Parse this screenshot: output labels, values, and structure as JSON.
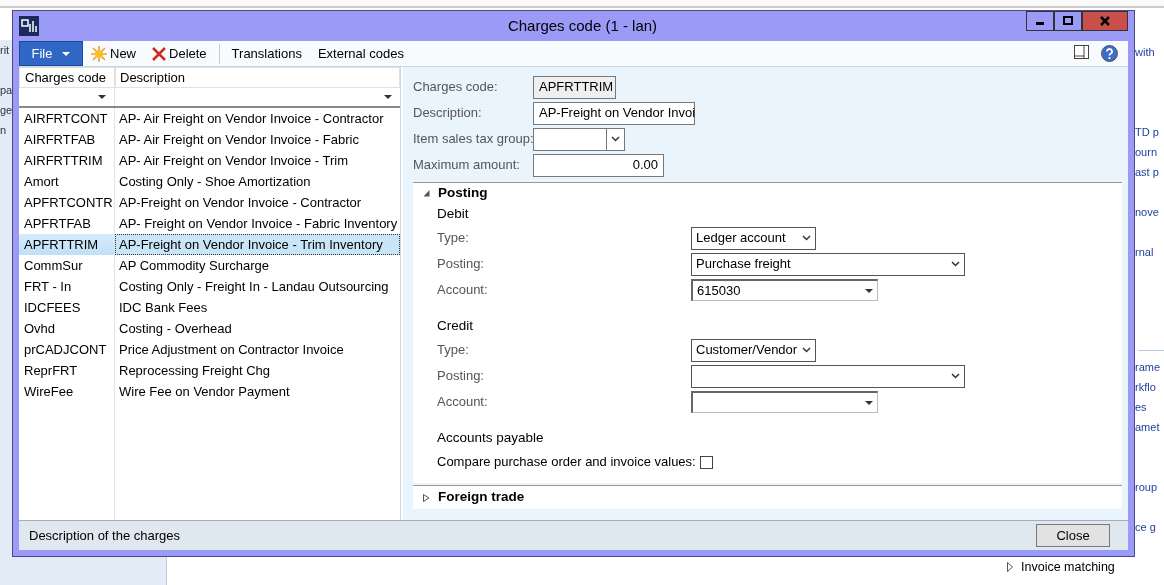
{
  "window": {
    "title": "Charges code (1 - lan)"
  },
  "toolbar": {
    "file_button": "File",
    "buttons": [
      {
        "label": "New",
        "kind": "new"
      },
      {
        "label": "Delete",
        "kind": "delete"
      },
      {
        "label": "Translations",
        "kind": "plain"
      },
      {
        "label": "External codes",
        "kind": "plain"
      }
    ]
  },
  "grid": {
    "columns": [
      "Charges code",
      "Description"
    ],
    "rows": [
      {
        "code": "AIRFRTCONT",
        "description": "AP- Air Freight on Vendor Invoice - Contractor",
        "selected": false
      },
      {
        "code": "AIRFRTFAB",
        "description": "AP- Air Freight on Vendor Invoice - Fabric",
        "selected": false
      },
      {
        "code": "AIRFRTTRIM",
        "description": "AP- Air Freight on Vendor Invoice - Trim",
        "selected": false
      },
      {
        "code": "Amort",
        "description": "Costing Only - Shoe Amortization",
        "selected": false
      },
      {
        "code": "APFRTCONTR",
        "description": "AP-Freight on Vendor Invoice - Contractor",
        "selected": false
      },
      {
        "code": "APFRTFAB",
        "description": "AP- Freight on Vendor Invoice - Fabric Inventory",
        "selected": false
      },
      {
        "code": "APFRTTRIM",
        "description": "AP-Freight on Vendor Invoice - Trim Inventory",
        "selected": true
      },
      {
        "code": "CommSur",
        "description": "AP Commodity Surcharge",
        "selected": false
      },
      {
        "code": "FRT - In",
        "description": "Costing Only - Freight In - Landau Outsourcing",
        "selected": false
      },
      {
        "code": "IDCFEES",
        "description": "IDC Bank Fees",
        "selected": false
      },
      {
        "code": "Ovhd",
        "description": "Costing - Overhead",
        "selected": false
      },
      {
        "code": "prCADJCONT",
        "description": "Price Adjustment on Contractor Invoice",
        "selected": false
      },
      {
        "code": "ReprFRT",
        "description": "Reprocessing Freight Chg",
        "selected": false
      },
      {
        "code": "WireFee",
        "description": "Wire Fee on Vendor Payment",
        "selected": false
      }
    ]
  },
  "header_fields": [
    {
      "label": "Charges code:",
      "value": "APFRTTRIM",
      "kind": "readonly"
    },
    {
      "label": "Description:",
      "value": "AP-Freight on Vendor Invoi",
      "kind": "text"
    },
    {
      "label": "Item sales tax group:",
      "kind": "combo"
    },
    {
      "label": "Maximum amount:",
      "value": "0.00",
      "kind": "number"
    }
  ],
  "posting": {
    "title": "Posting",
    "expanded": true,
    "groups": [
      {
        "title": "Debit",
        "fields": [
          {
            "label": "Type:",
            "value": "Ledger account",
            "kind": "select"
          },
          {
            "label": "Posting:",
            "value": "Purchase freight",
            "kind": "wide-select"
          },
          {
            "label": "Account:",
            "value": "615030",
            "kind": "lookup"
          }
        ]
      },
      {
        "title": "Credit",
        "fields": [
          {
            "label": "Type:",
            "value": "Customer/Vendor",
            "kind": "select"
          },
          {
            "label": "Posting:",
            "kind": "wide-select"
          },
          {
            "label": "Account:",
            "kind": "lookup"
          }
        ]
      }
    ],
    "accounts_payable": {
      "title": "Accounts payable",
      "checkbox_label": "Compare purchase order and invoice values:",
      "checked": false
    }
  },
  "foreign_trade": {
    "title": "Foreign trade",
    "expanded": false
  },
  "status_bar": {
    "text": "Description of the charges",
    "close_button": "Close"
  },
  "background": {
    "left_fragments": [
      "rit",
      "pa",
      "ge",
      "n"
    ],
    "right_fragments": [
      "with",
      "TD p",
      "ourn",
      "ast p",
      "nove",
      "rnal",
      "rame",
      "rkflo",
      "es",
      "amet",
      "roup",
      "ce g"
    ],
    "bottom_item": "Invoice matching"
  }
}
